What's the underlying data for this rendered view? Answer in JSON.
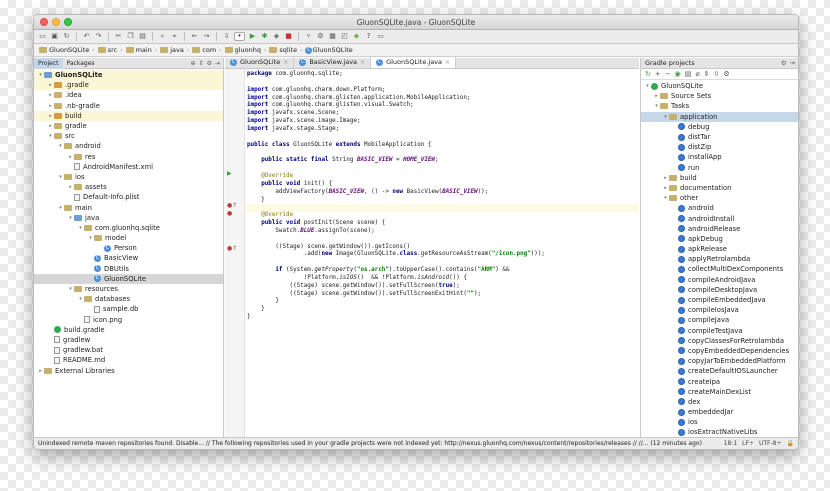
{
  "window": {
    "title": "GluonSQLite.java - GluonSQLite"
  },
  "toolbar": {
    "config_selector": "▾"
  },
  "breadcrumb": [
    {
      "label": "GluonSQLite"
    },
    {
      "label": "src"
    },
    {
      "label": "main"
    },
    {
      "label": "java"
    },
    {
      "label": "com"
    },
    {
      "label": "gluonhq"
    },
    {
      "label": "sqlite"
    },
    {
      "label": "GluonSQLite"
    }
  ],
  "project_tabs": {
    "project": "Project",
    "packages": "Packages"
  },
  "project_tree": [
    {
      "label": "GluonSQLite",
      "depth": 0,
      "arrow": "▾",
      "icon": "folder-blue",
      "bold": true,
      "hl": "yellow"
    },
    {
      "label": ".gradle",
      "depth": 1,
      "arrow": "▸",
      "icon": "folder-orange",
      "hl": "yellow"
    },
    {
      "label": ".idea",
      "depth": 1,
      "arrow": "▸",
      "icon": "folder"
    },
    {
      "label": ".nb-gradle",
      "depth": 1,
      "arrow": "▸",
      "icon": "folder"
    },
    {
      "label": "build",
      "depth": 1,
      "arrow": "▸",
      "icon": "folder-orange",
      "hl": "yellow"
    },
    {
      "label": "gradle",
      "depth": 1,
      "arrow": "▸",
      "icon": "folder"
    },
    {
      "label": "src",
      "depth": 1,
      "arrow": "▾",
      "icon": "folder"
    },
    {
      "label": "android",
      "depth": 2,
      "arrow": "▾",
      "icon": "folder"
    },
    {
      "label": "res",
      "depth": 3,
      "arrow": "▸",
      "icon": "folder"
    },
    {
      "label": "AndroidManifest.xml",
      "depth": 3,
      "arrow": "",
      "icon": "file"
    },
    {
      "label": "ios",
      "depth": 2,
      "arrow": "▾",
      "icon": "folder"
    },
    {
      "label": "assets",
      "depth": 3,
      "arrow": "▸",
      "icon": "folder"
    },
    {
      "label": "Default-Info.plist",
      "depth": 3,
      "arrow": "",
      "icon": "file"
    },
    {
      "label": "main",
      "depth": 2,
      "arrow": "▾",
      "icon": "folder"
    },
    {
      "label": "java",
      "depth": 3,
      "arrow": "▾",
      "icon": "folder-blue"
    },
    {
      "label": "com.gluonhq.sqlite",
      "depth": 4,
      "arrow": "▾",
      "icon": "folder"
    },
    {
      "label": "model",
      "depth": 5,
      "arrow": "▾",
      "icon": "folder"
    },
    {
      "label": "Person",
      "depth": 6,
      "arrow": "",
      "icon": "class"
    },
    {
      "label": "BasicView",
      "depth": 5,
      "arrow": "",
      "icon": "class"
    },
    {
      "label": "DBUtils",
      "depth": 5,
      "arrow": "",
      "icon": "class"
    },
    {
      "label": "GluonSQLite",
      "depth": 5,
      "arrow": "",
      "icon": "class",
      "hl": "sel"
    },
    {
      "label": "resources",
      "depth": 3,
      "arrow": "▾",
      "icon": "folder"
    },
    {
      "label": "databases",
      "depth": 4,
      "arrow": "▾",
      "icon": "folder"
    },
    {
      "label": "sample.db",
      "depth": 5,
      "arrow": "",
      "icon": "file"
    },
    {
      "label": "icon.png",
      "depth": 4,
      "arrow": "",
      "icon": "file"
    },
    {
      "label": "build.gradle",
      "depth": 1,
      "arrow": "",
      "icon": "gradle"
    },
    {
      "label": "gradlew",
      "depth": 1,
      "arrow": "",
      "icon": "file"
    },
    {
      "label": "gradlew.bat",
      "depth": 1,
      "arrow": "",
      "icon": "file"
    },
    {
      "label": "README.md",
      "depth": 1,
      "arrow": "",
      "icon": "file"
    },
    {
      "label": "External Libraries",
      "depth": 0,
      "arrow": "▸",
      "icon": "folder"
    }
  ],
  "editor_tabs": [
    {
      "label": "GluonSQLite",
      "active": false
    },
    {
      "label": "BasicView.java",
      "active": false
    },
    {
      "label": "GluonSQLite.java",
      "active": true
    }
  ],
  "code_lines": [
    "<span class='kw'>package</span> com.gluonhq.sqlite;",
    "",
    "<span class='kw'>import</span> com.gluonhq.charm.down.Platform;",
    "<span class='kw'>import</span> com.gluonhq.charm.glisten.application.MobileApplication;",
    "<span class='kw'>import</span> com.gluonhq.charm.glisten.visual.Swatch;",
    "<span class='kw'>import</span> javafx.scene.Scene;",
    "<span class='kw'>import</span> javafx.scene.image.Image;",
    "<span class='kw'>import</span> javafx.stage.Stage;",
    "",
    "<span class='kw'>public class</span> GluonSQLite <span class='kw'>extends</span> MobileApplication {",
    "",
    "    <span class='kw'>public static final</span> String <span class='fld'>BASIC_VIEW</span> = <span class='fld'>HOME_VIEW</span>;",
    "",
    "    <span class='ann'>@Override</span>",
    "    <span class='kw'>public void</span> init() {",
    "        addViewFactory(<span class='fld'>BASIC_VIEW</span>, () -> <span class='kw'>new</span> BasicView(<span class='fld'>BASIC_VIEW</span>));",
    "    }",
    "",
    "    <span class='ann'>@Override</span>",
    "    <span class='kw'>public void</span> postInit(Scene scene) {",
    "        Swatch.<span class='fld'>BLUE</span>.assignTo(scene);",
    "",
    "        ((Stage) scene.getWindow()).getIcons()",
    "                .add(<span class='kw'>new</span> Image(GluonSQLite.<span class='kw'>class</span>.getResourceAsStream(<span class='str'>\"/icon.png\"</span>)));",
    "",
    "        <span class='kw'>if</span> (System.<span class='it'>getProperty</span>(<span class='str'>\"os.arch\"</span>).toUpperCase().contains(<span class='str'>\"ARM\"</span>) &&",
    "                !Platform.<span class='it'>isIOS</span>()  && !Platform.<span class='it'>isAndroid</span>()) {",
    "            ((Stage) scene.getWindow()).setFullScreen(<span class='kw'>true</span>);",
    "            ((Stage) scene.getWindow()).setFullScreenExitHint(<span class='str'>\"\"</span>);",
    "        }",
    "    }",
    "}"
  ],
  "gradle": {
    "title": "Gradle projects",
    "tree": [
      {
        "label": "GluonSQLite",
        "depth": 0,
        "arrow": "▾",
        "icon": "gradle"
      },
      {
        "label": "Source Sets",
        "depth": 1,
        "arrow": "▸",
        "icon": "folder"
      },
      {
        "label": "Tasks",
        "depth": 1,
        "arrow": "▾",
        "icon": "folder"
      },
      {
        "label": "application",
        "depth": 2,
        "arrow": "▾",
        "icon": "folder",
        "sel": true
      },
      {
        "label": "debug",
        "depth": 3,
        "arrow": "",
        "icon": "gear"
      },
      {
        "label": "distTar",
        "depth": 3,
        "arrow": "",
        "icon": "gear"
      },
      {
        "label": "distZip",
        "depth": 3,
        "arrow": "",
        "icon": "gear"
      },
      {
        "label": "installApp",
        "depth": 3,
        "arrow": "",
        "icon": "gear"
      },
      {
        "label": "run",
        "depth": 3,
        "arrow": "",
        "icon": "gear"
      },
      {
        "label": "build",
        "depth": 2,
        "arrow": "▸",
        "icon": "folder"
      },
      {
        "label": "documentation",
        "depth": 2,
        "arrow": "▸",
        "icon": "folder"
      },
      {
        "label": "other",
        "depth": 2,
        "arrow": "▾",
        "icon": "folder"
      },
      {
        "label": "android",
        "depth": 3,
        "arrow": "",
        "icon": "gear"
      },
      {
        "label": "androidInstall",
        "depth": 3,
        "arrow": "",
        "icon": "gear"
      },
      {
        "label": "androidRelease",
        "depth": 3,
        "arrow": "",
        "icon": "gear"
      },
      {
        "label": "apkDebug",
        "depth": 3,
        "arrow": "",
        "icon": "gear"
      },
      {
        "label": "apkRelease",
        "depth": 3,
        "arrow": "",
        "icon": "gear"
      },
      {
        "label": "applyRetrolambda",
        "depth": 3,
        "arrow": "",
        "icon": "gear"
      },
      {
        "label": "collectMultiDexComponents",
        "depth": 3,
        "arrow": "",
        "icon": "gear"
      },
      {
        "label": "compileAndroidJava",
        "depth": 3,
        "arrow": "",
        "icon": "gear"
      },
      {
        "label": "compileDesktopJava",
        "depth": 3,
        "arrow": "",
        "icon": "gear"
      },
      {
        "label": "compileEmbeddedJava",
        "depth": 3,
        "arrow": "",
        "icon": "gear"
      },
      {
        "label": "compileIosJava",
        "depth": 3,
        "arrow": "",
        "icon": "gear"
      },
      {
        "label": "compileJava",
        "depth": 3,
        "arrow": "",
        "icon": "gear"
      },
      {
        "label": "compileTestJava",
        "depth": 3,
        "arrow": "",
        "icon": "gear"
      },
      {
        "label": "copyClassesForRetrolambda",
        "depth": 3,
        "arrow": "",
        "icon": "gear"
      },
      {
        "label": "copyEmbeddedDependencies",
        "depth": 3,
        "arrow": "",
        "icon": "gear"
      },
      {
        "label": "copyJarToEmbeddedPlatform",
        "depth": 3,
        "arrow": "",
        "icon": "gear"
      },
      {
        "label": "createDefaultIOSLauncher",
        "depth": 3,
        "arrow": "",
        "icon": "gear"
      },
      {
        "label": "createIpa",
        "depth": 3,
        "arrow": "",
        "icon": "gear"
      },
      {
        "label": "createMainDexList",
        "depth": 3,
        "arrow": "",
        "icon": "gear"
      },
      {
        "label": "dex",
        "depth": 3,
        "arrow": "",
        "icon": "gear"
      },
      {
        "label": "embeddedJar",
        "depth": 3,
        "arrow": "",
        "icon": "gear"
      },
      {
        "label": "ios",
        "depth": 3,
        "arrow": "",
        "icon": "gear"
      },
      {
        "label": "iosExtractNativeLibs",
        "depth": 3,
        "arrow": "",
        "icon": "gear"
      }
    ]
  },
  "status": {
    "message": "Unindexed remote maven repositories found. Disable... // The following repositories used in your gradle projects were not indexed yet: http://nexus.gluonhq.com/nexus/content/repositories/releases // //... (12 minutes ago)",
    "position": "18:1",
    "line_sep": "LF÷",
    "encoding": "UTF-8÷"
  }
}
